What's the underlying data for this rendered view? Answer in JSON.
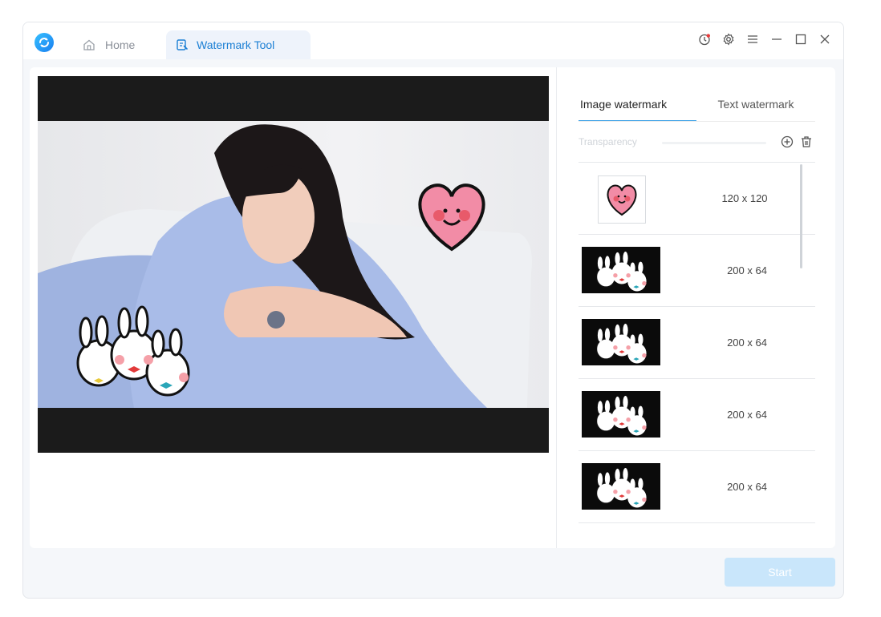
{
  "app": {
    "tabs": {
      "home": "Home",
      "watermark": "Watermark Tool"
    },
    "window_controls": [
      "history-icon",
      "settings-icon",
      "menu-icon",
      "minimize-icon",
      "maximize-icon",
      "close-icon"
    ],
    "accent_color": "#1b7fd4"
  },
  "panel": {
    "tab_image": "Image watermark",
    "tab_text": "Text watermark",
    "active_tab": "Image watermark",
    "transparency_label": "Transparency",
    "items": [
      {
        "size": "120 x 120",
        "thumb": "heart-face"
      },
      {
        "size": "200 x 64",
        "thumb": "bunnies"
      },
      {
        "size": "200 x 64",
        "thumb": "bunnies"
      },
      {
        "size": "200 x 64",
        "thumb": "bunnies"
      },
      {
        "size": "200 x 64",
        "thumb": "bunnies"
      }
    ]
  },
  "footer": {
    "start_label": "Start"
  }
}
